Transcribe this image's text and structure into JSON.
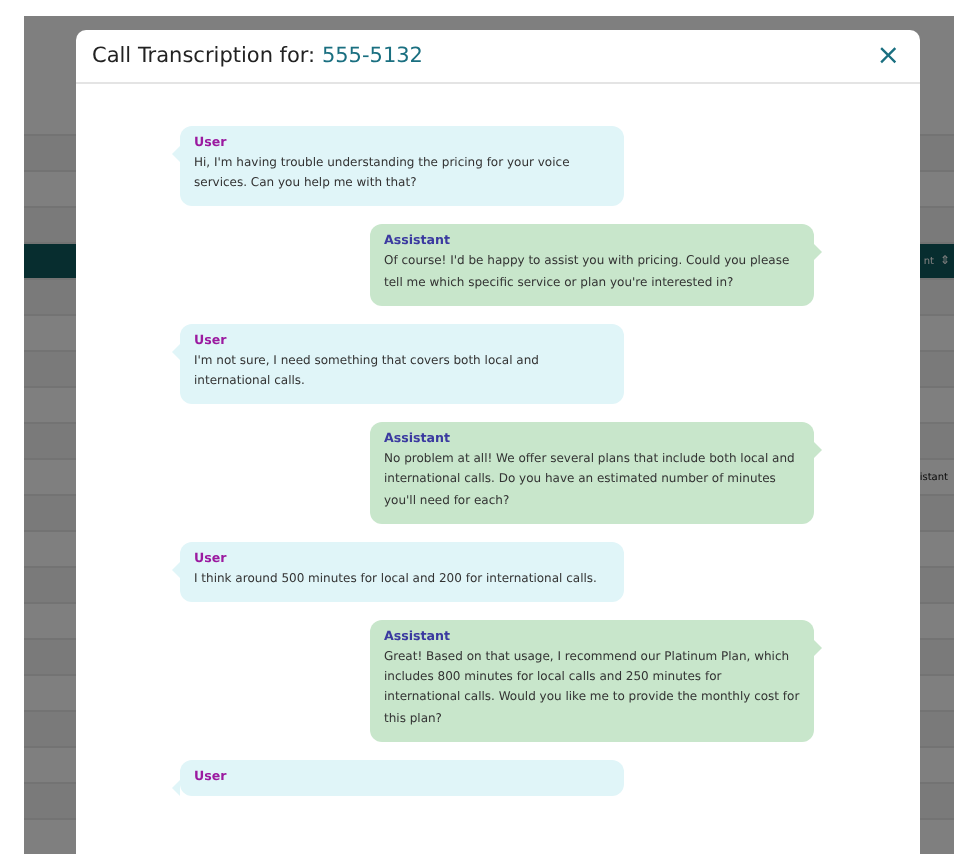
{
  "background": {
    "header_fragment": "nt",
    "sort_icon": "⇕",
    "cell_fragment": "istant"
  },
  "dialog": {
    "title": "Call Transcription for:",
    "number": "555-5132",
    "close": "×",
    "messages": [
      {
        "kind": "user",
        "speaker": "User",
        "text": "Hi, I'm having trouble understanding the pricing for your voice services. Can you help me with that?"
      },
      {
        "kind": "assistant",
        "speaker": "Assistant",
        "text": "Of course! I'd be happy to assist you with pricing. Could you please tell me which specific service or plan you're interested in?"
      },
      {
        "kind": "user",
        "speaker": "User",
        "text": "I'm not sure, I need something that covers both local and international calls."
      },
      {
        "kind": "assistant",
        "speaker": "Assistant",
        "text": "No problem at all! We offer several plans that include both local and international calls. Do you have an estimated number of minutes you'll need for each?"
      },
      {
        "kind": "user",
        "speaker": "User",
        "text": "I think around 500 minutes for local and 200 for international calls."
      },
      {
        "kind": "assistant",
        "speaker": "Assistant",
        "text": "Great! Based on that usage, I recommend our Platinum Plan, which includes 800 minutes for local calls and 250 minutes for international calls. Would you like me to provide the monthly cost for this plan?"
      },
      {
        "kind": "user",
        "speaker": "User"
      }
    ]
  }
}
